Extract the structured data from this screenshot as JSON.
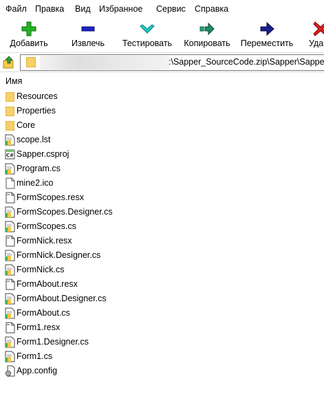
{
  "menu": [
    "Файл",
    "Правка",
    "Вид",
    "Избранное",
    "Сервис",
    "Справка"
  ],
  "toolbar": {
    "add": "Добавить",
    "extract": "Извлечь",
    "test": "Тестировать",
    "copy": "Копировать",
    "move": "Переместить",
    "delete": "Уда"
  },
  "address": {
    "path": ":\\Sapper_SourceCode.zip\\Sapper\\Sapper\\"
  },
  "list": {
    "column_name": "Имя",
    "items": [
      {
        "name": "Resources",
        "type": "folder"
      },
      {
        "name": "Properties",
        "type": "folder"
      },
      {
        "name": "Core",
        "type": "folder"
      },
      {
        "name": "scope.lst",
        "type": "text"
      },
      {
        "name": "Sapper.csproj",
        "type": "csproj"
      },
      {
        "name": "Program.cs",
        "type": "cs"
      },
      {
        "name": "mine2.ico",
        "type": "blank"
      },
      {
        "name": "FormScopes.resx",
        "type": "resx"
      },
      {
        "name": "FormScopes.Designer.cs",
        "type": "cs"
      },
      {
        "name": "FormScopes.cs",
        "type": "cs"
      },
      {
        "name": "FormNick.resx",
        "type": "resx"
      },
      {
        "name": "FormNick.Designer.cs",
        "type": "cs"
      },
      {
        "name": "FormNick.cs",
        "type": "cs"
      },
      {
        "name": "FormAbout.resx",
        "type": "resx"
      },
      {
        "name": "FormAbout.Designer.cs",
        "type": "cs"
      },
      {
        "name": "FormAbout.cs",
        "type": "cs"
      },
      {
        "name": "Form1.resx",
        "type": "resx"
      },
      {
        "name": "Form1.Designer.cs",
        "type": "cs"
      },
      {
        "name": "Form1.cs",
        "type": "cs"
      },
      {
        "name": "App.config",
        "type": "config"
      }
    ]
  },
  "colors": {
    "add_icon": "#1fb21f",
    "extract_icon": "#1d22c8",
    "test_icon": "#1ec9c9",
    "copy_icon": "#1a8a6a",
    "move_icon": "#1a1f8c",
    "delete_icon": "#d81f1f",
    "folder": "#f6d16b"
  }
}
